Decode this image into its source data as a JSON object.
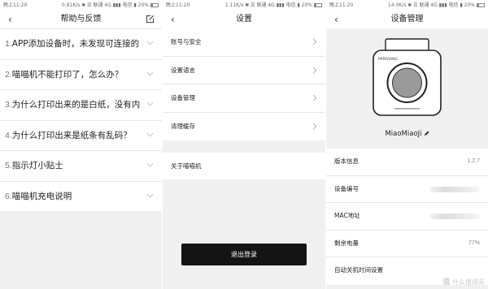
{
  "status_bars": [
    {
      "time": "晚上11:20",
      "right": "0.81K/s ✱ ☰ 联通 4G ▮▮▮ 电信 ▮ 20%"
    },
    {
      "time": "晚上11:20",
      "right": "1.11K/s ✱ ☰ 联通 4G ▮▮▮ 电信 ▮ 20%"
    },
    {
      "time": "晚上11:20",
      "right": "14.0K/s ✱ ☰ 联通 4G ▮▮▮ 电信 ▮ 20%"
    }
  ],
  "help": {
    "title": "帮助与反馈",
    "back_icon": "chevron-left-icon",
    "edit_icon": "edit-icon",
    "items": [
      {
        "num": "1.",
        "text": "APP添加设备时，未发现可连接的"
      },
      {
        "num": "2.",
        "text": "喵喵机不能打印了，怎么办？"
      },
      {
        "num": "3.",
        "text": "为什么打印出来的是白纸，没有内"
      },
      {
        "num": "4.",
        "text": "为什么打印出来是纸条有乱码？"
      },
      {
        "num": "5.",
        "text": "指示灯小贴士"
      },
      {
        "num": "6.",
        "text": "喵喵机充电说明"
      }
    ]
  },
  "settings": {
    "title": "设置",
    "items": [
      {
        "label": "账号与安全"
      },
      {
        "label": "设置语言"
      },
      {
        "label": "设备管理"
      },
      {
        "label": "清理缓存"
      }
    ],
    "about": "关于喵喵机",
    "logout": "退出登录"
  },
  "device": {
    "title": "设备管理",
    "brand_on_device": "PAPERANG",
    "name": "MiaoMiaoJi",
    "info": [
      {
        "label": "版本信息",
        "value": "1.2.7"
      },
      {
        "label": "设备编号",
        "value": ""
      },
      {
        "label": "MAC地址",
        "value": ""
      },
      {
        "label": "剩余电量",
        "value": "77%"
      },
      {
        "label": "自动关机时间设置",
        "value": ""
      }
    ]
  },
  "watermark": {
    "big": "值",
    "small": "什么值得买"
  }
}
